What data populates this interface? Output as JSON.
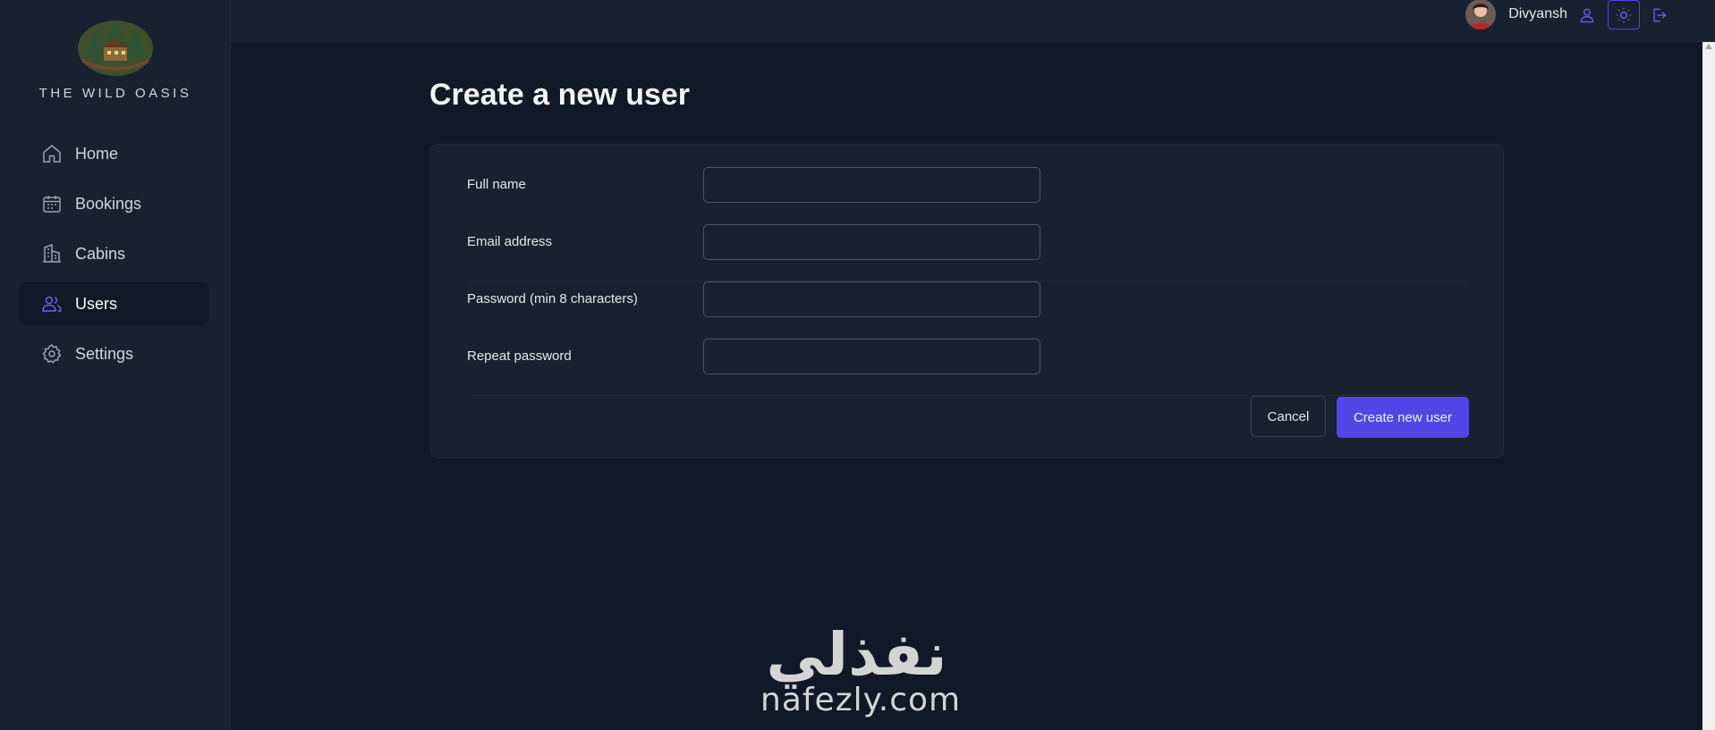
{
  "brand": {
    "name": "THE WILD OASIS"
  },
  "sidebar": {
    "items": [
      {
        "label": "Home",
        "icon": "home-icon",
        "active": false
      },
      {
        "label": "Bookings",
        "icon": "calendar-icon",
        "active": false
      },
      {
        "label": "Cabins",
        "icon": "building-icon",
        "active": false
      },
      {
        "label": "Users",
        "icon": "users-icon",
        "active": true
      },
      {
        "label": "Settings",
        "icon": "gear-icon",
        "active": false
      }
    ]
  },
  "header": {
    "username": "Divyansh",
    "buttons": [
      "user-icon",
      "sun-icon",
      "logout-icon"
    ]
  },
  "main": {
    "title": "Create a new user",
    "form": {
      "fields": [
        {
          "label": "Full name",
          "value": ""
        },
        {
          "label": "Email address",
          "value": ""
        },
        {
          "label": "Password (min 8 characters)",
          "value": ""
        },
        {
          "label": "Repeat password",
          "value": ""
        }
      ],
      "cancel_label": "Cancel",
      "submit_label": "Create new user"
    }
  },
  "watermark": {
    "arabic": "نفذلي",
    "latin": "nafezly.com"
  },
  "colors": {
    "accent": "#4f46e5",
    "background": "#111827",
    "panel": "#18212f",
    "border": "#374151"
  }
}
